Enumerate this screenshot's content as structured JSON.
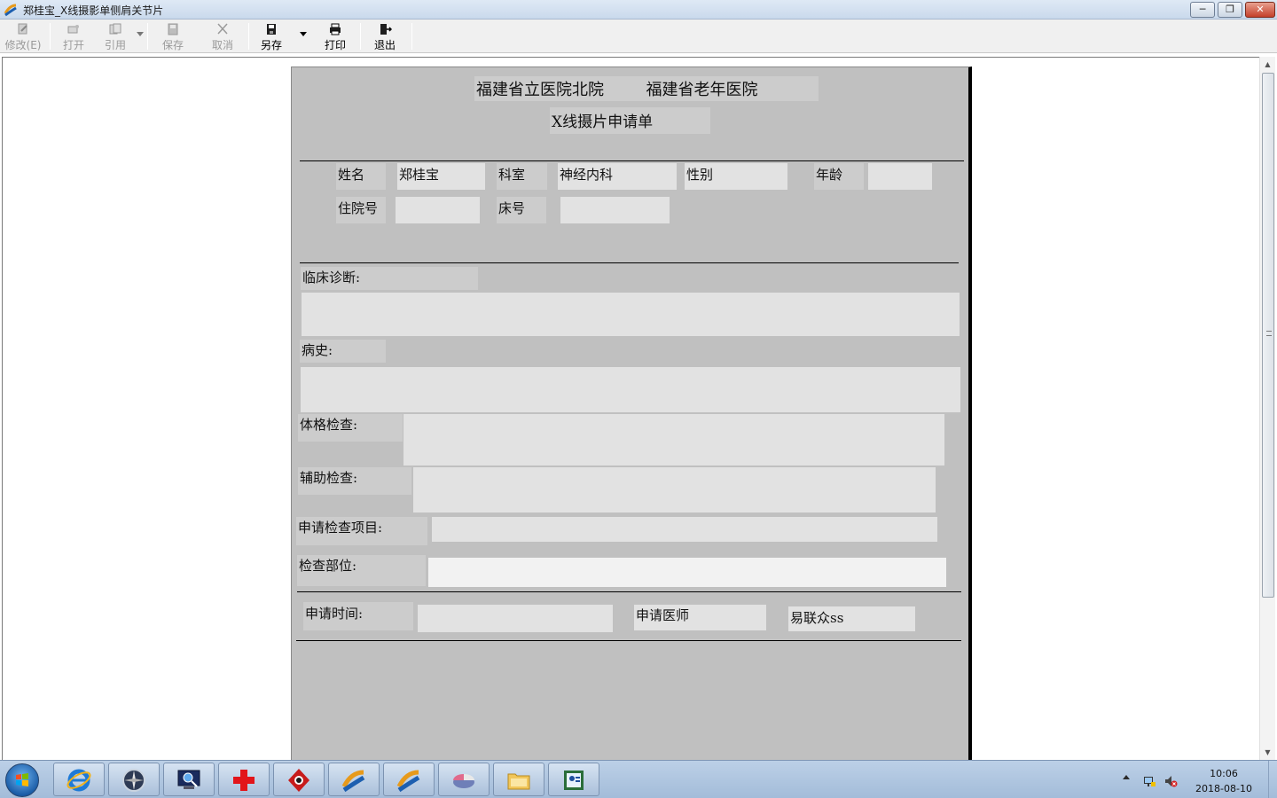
{
  "window": {
    "title": "郑桂宝_X线摄影单侧肩关节片",
    "minimize_glyph": "─",
    "maximize_glyph": "❐",
    "close_glyph": "✕"
  },
  "toolbar": {
    "modify_label": "修改(E)",
    "open_label": "打开",
    "reference_label": "引用",
    "save_label": "保存",
    "cancel_label": "取消",
    "save_as_label": "另存",
    "print_label": "打印",
    "exit_label": "退出"
  },
  "form": {
    "hospital_name_1": "福建省立医院北院",
    "hospital_name_2": "福建省老年医院",
    "form_title": "X线摄片申请单",
    "name_label": "姓名",
    "name_value": "郑桂宝",
    "dept_label": "科室",
    "dept_value": "神经内科",
    "gender_label": "性别",
    "gender_value": "",
    "age_label": "年龄",
    "age_value": "",
    "inpatient_no_label": "住院号",
    "inpatient_no_value": "",
    "bed_no_label": "床号",
    "bed_no_value": "",
    "clinical_diagnosis_label": "临床诊断:",
    "clinical_diagnosis_value": "",
    "history_label": "病史:",
    "history_value": "",
    "physical_exam_label": "体格检查:",
    "physical_exam_value": "",
    "aux_exam_label": "辅助检查:",
    "aux_exam_value": "",
    "requested_items_label": "申请检查项目:",
    "requested_items_value": "",
    "exam_site_label": "检查部位:",
    "exam_site_value": "",
    "request_time_label": "申请时间:",
    "request_time_value": "",
    "requesting_doctor_label": "申请医师",
    "requesting_doctor_value": "易联众ss"
  },
  "taskbar": {
    "icons": [
      "start-orb",
      "internet-explorer-icon",
      "compass-app-icon",
      "monitor-search-icon",
      "red-cross-icon",
      "shield-app-icon",
      "his-client-icon",
      "his-client-icon-2",
      "pie-chart-icon",
      "folder-icon",
      "id-card-app-icon"
    ],
    "clock_time": "10:06",
    "clock_date": "2018-08-10"
  },
  "colors": {
    "paper_bg": "#c0c0c0",
    "field_bg": "#e2e2e2",
    "label_bg": "#cccccc",
    "taskbar_bg": "#a9c0dc"
  }
}
